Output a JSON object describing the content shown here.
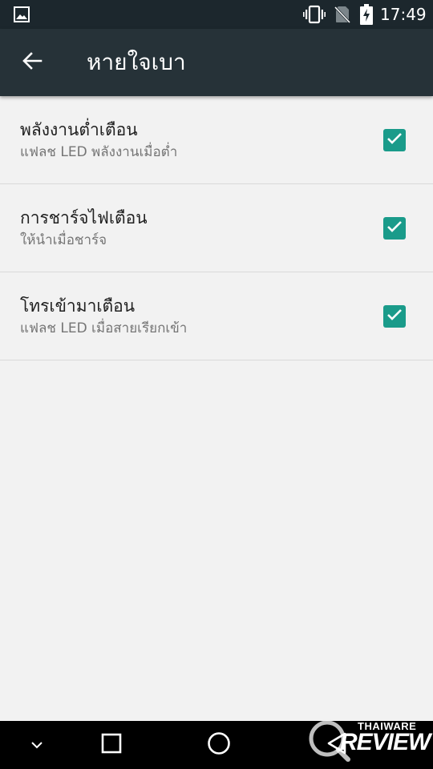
{
  "status_bar": {
    "time": "17:49",
    "icons": [
      "gallery-icon",
      "vibrate-icon",
      "no-sim-icon",
      "battery-charging-icon"
    ]
  },
  "app_bar": {
    "title": "หายใจเบา",
    "back_icon": "back-arrow-icon"
  },
  "settings": [
    {
      "title": "พลังงานต่ำเตือน",
      "subtitle": "แฟลช LED พลังงานเมื่อต่ำ",
      "checked": true
    },
    {
      "title": "การชาร์จไฟเตือน",
      "subtitle": "ให้นำเมื่อชาร์จ",
      "checked": true
    },
    {
      "title": "โทรเข้ามาเตือน",
      "subtitle": "แฟลช LED เมื่อสายเรียกเข้า",
      "checked": true
    }
  ],
  "nav_bar": {
    "icons": [
      "chevron-down-icon",
      "recents-icon",
      "home-icon",
      "back-triangle-icon"
    ]
  },
  "watermark": {
    "top": "THAIWARE",
    "main": "REVIEW"
  },
  "colors": {
    "status_bar": "#1c272d",
    "app_bar": "#263238",
    "background": "#f2f2f2",
    "accent": "#1a9b8a"
  }
}
